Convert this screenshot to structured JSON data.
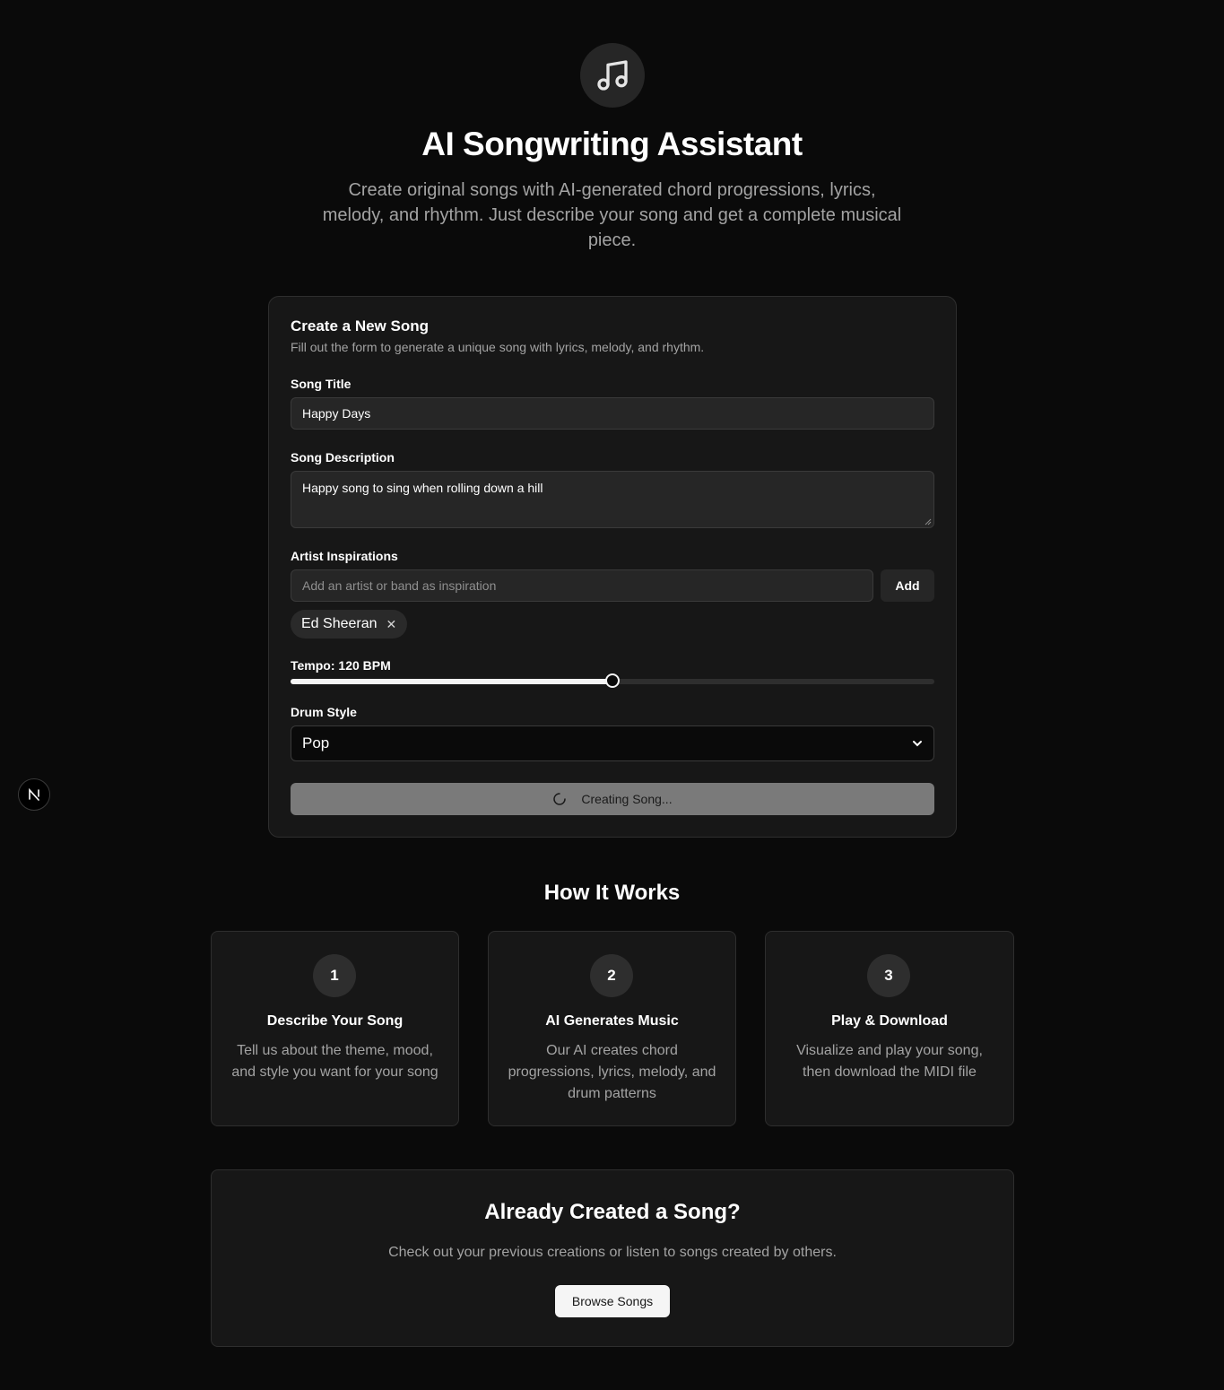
{
  "hero": {
    "icon": "music-note-icon",
    "title": "AI Songwriting Assistant",
    "subtitle": "Create original songs with AI-generated chord progressions, lyrics, melody, and rhythm. Just describe your song and get a complete musical piece."
  },
  "form": {
    "title": "Create a New Song",
    "description": "Fill out the form to generate a unique song with lyrics, melody, and rhythm.",
    "song_title_label": "Song Title",
    "song_title_value": "Happy Days",
    "song_description_label": "Song Description",
    "song_description_value": "Happy song to sing when rolling down a hill",
    "artist_label": "Artist Inspirations",
    "artist_placeholder": "Add an artist or band as inspiration",
    "add_label": "Add",
    "artists": [
      "Ed Sheeran"
    ],
    "tempo_label": "Tempo: 120 BPM",
    "tempo_fraction": 0.5,
    "drum_label": "Drum Style",
    "drum_value": "Pop",
    "submit_label": "Creating Song..."
  },
  "how": {
    "title": "How It Works",
    "steps": [
      {
        "num": "1",
        "title": "Describe Your Song",
        "text": "Tell us about the theme, mood, and style you want for your song"
      },
      {
        "num": "2",
        "title": "AI Generates Music",
        "text": "Our AI creates chord progressions, lyrics, melody, and drum patterns"
      },
      {
        "num": "3",
        "title": "Play & Download",
        "text": "Visualize and play your song, then download the MIDI file"
      }
    ]
  },
  "cta": {
    "title": "Already Created a Song?",
    "text": "Check out your previous creations or listen to songs created by others.",
    "button": "Browse Songs"
  },
  "colors": {
    "background": "#0a0a0a",
    "card": "#171717",
    "accent": "#f5f5f5",
    "muted_text": "#a3a3a3"
  }
}
